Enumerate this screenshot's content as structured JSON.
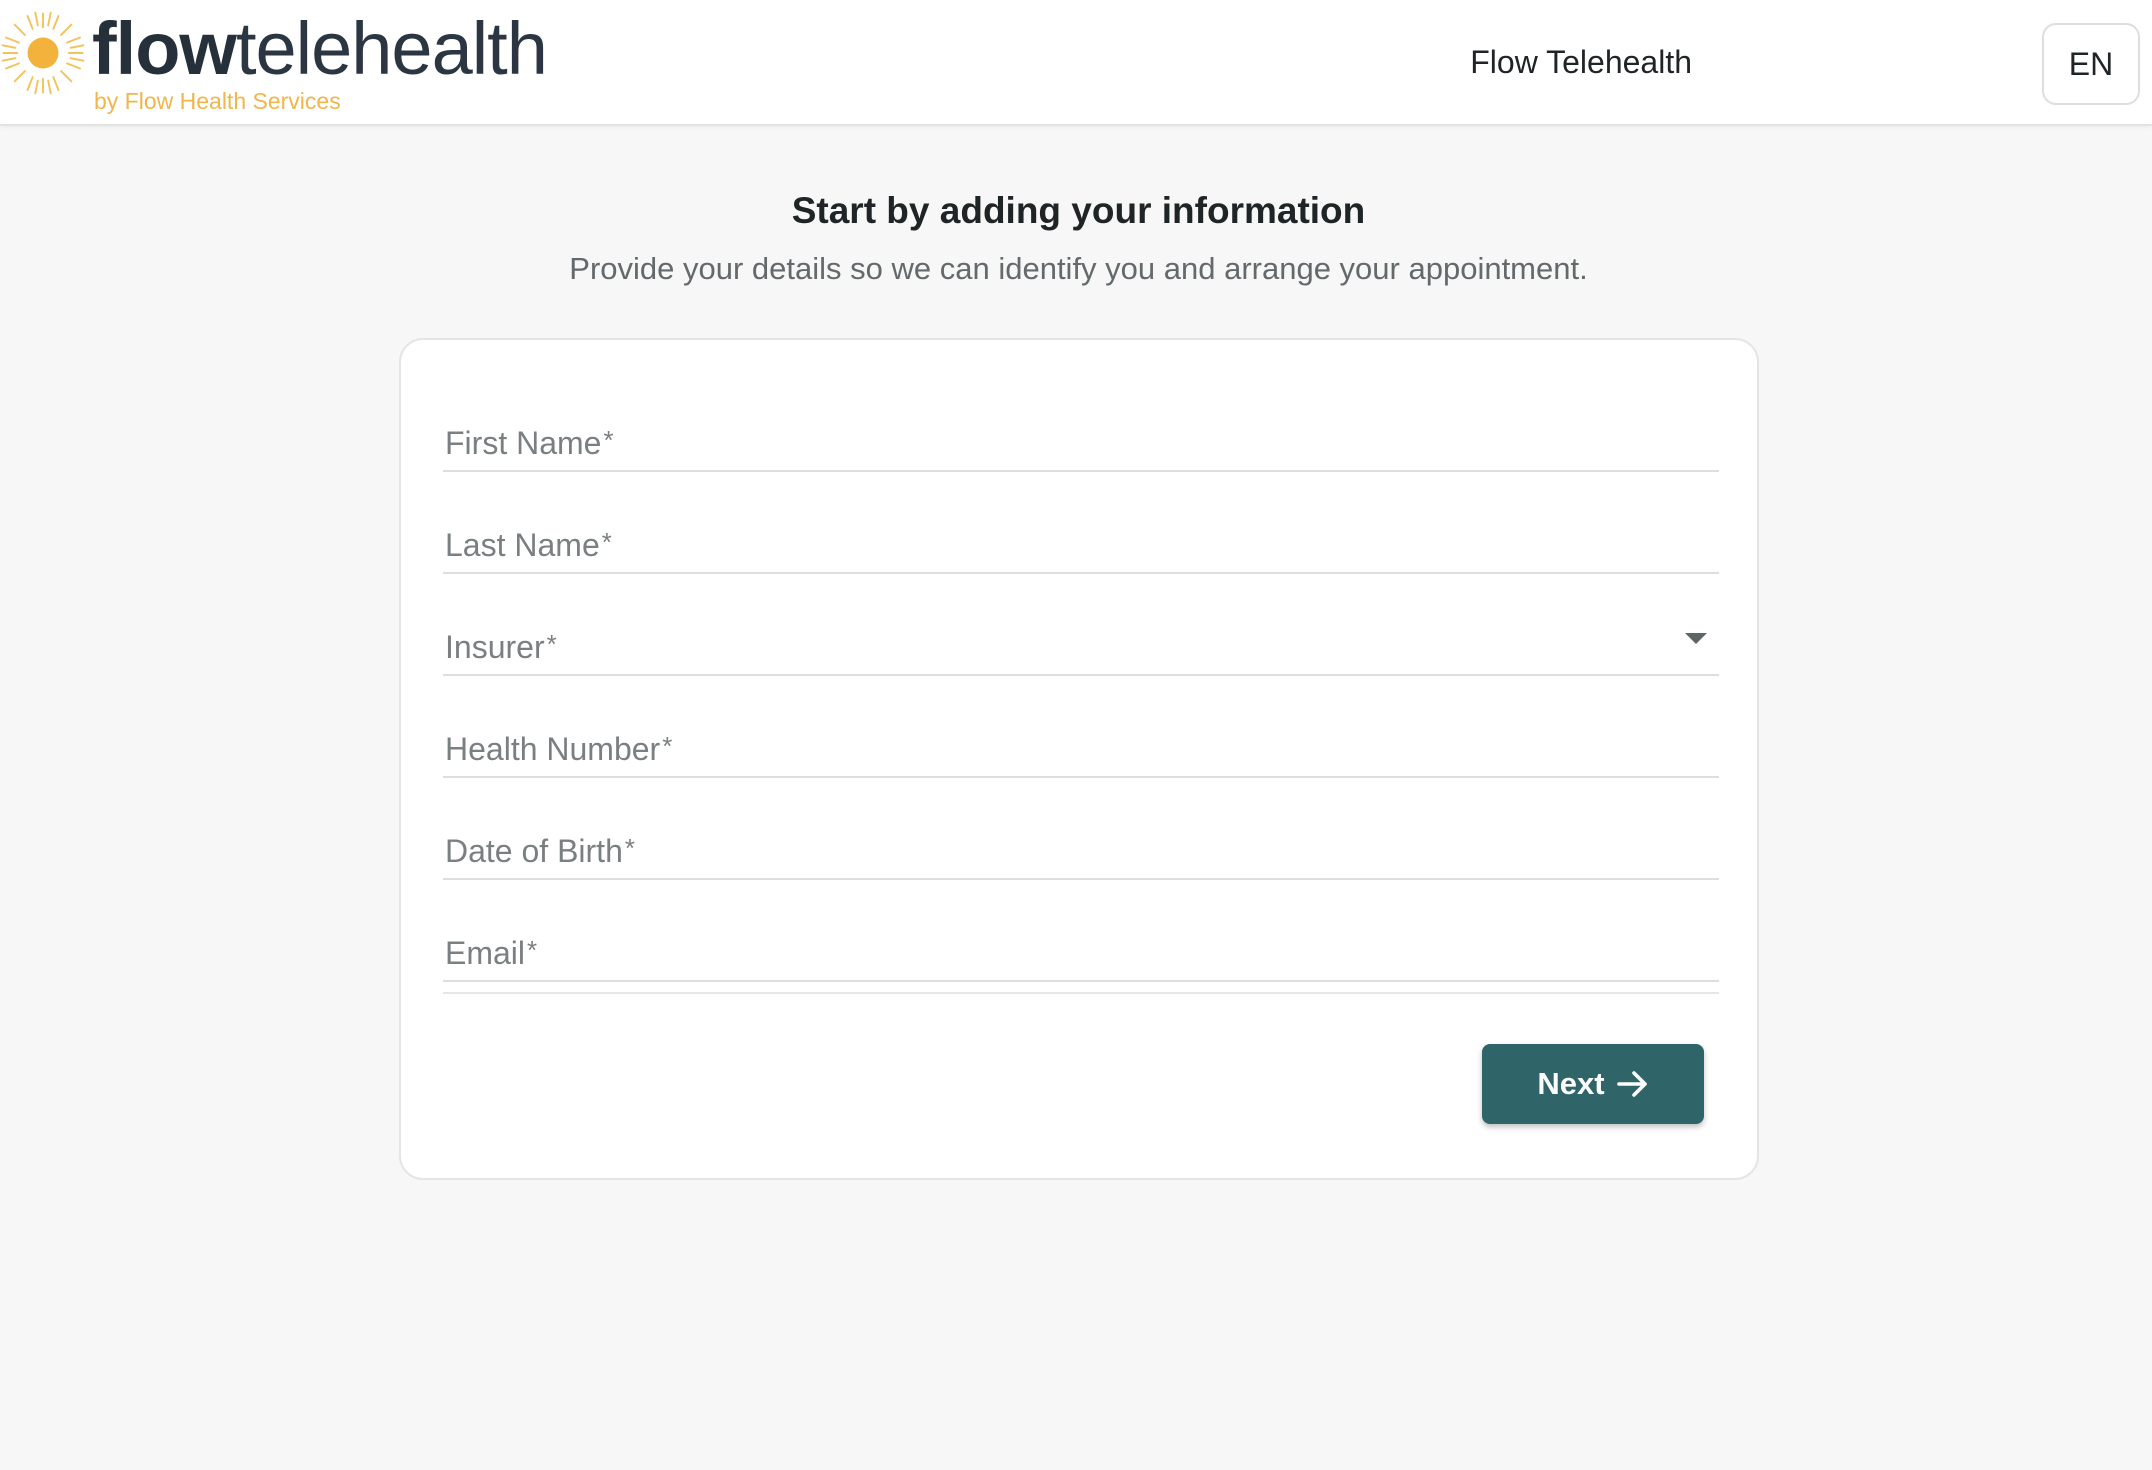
{
  "header": {
    "logo": {
      "word_bold": "flow",
      "word_regular": "telehealth",
      "tagline": "by Flow Health Services"
    },
    "brand_link": "Flow Telehealth",
    "language": "EN"
  },
  "main": {
    "title": "Start by adding your information",
    "subtitle": "Provide your details so we can identify you and arrange your appointment."
  },
  "form": {
    "required_marker": "*",
    "fields": [
      {
        "label": "First Name",
        "type": "text"
      },
      {
        "label": "Last Name",
        "type": "text"
      },
      {
        "label": "Insurer",
        "type": "select"
      },
      {
        "label": "Health Number",
        "type": "text"
      },
      {
        "label": "Date of Birth",
        "type": "text"
      },
      {
        "label": "Email",
        "type": "text"
      }
    ],
    "next_label": "Next"
  },
  "colors": {
    "primary": "#2f6569",
    "accent": "#f0b64a",
    "background": "#f6f7f6"
  },
  "icons": {
    "logo": "sun-icon",
    "dropdown": "chevron-down-icon",
    "next": "arrow-right-icon"
  }
}
